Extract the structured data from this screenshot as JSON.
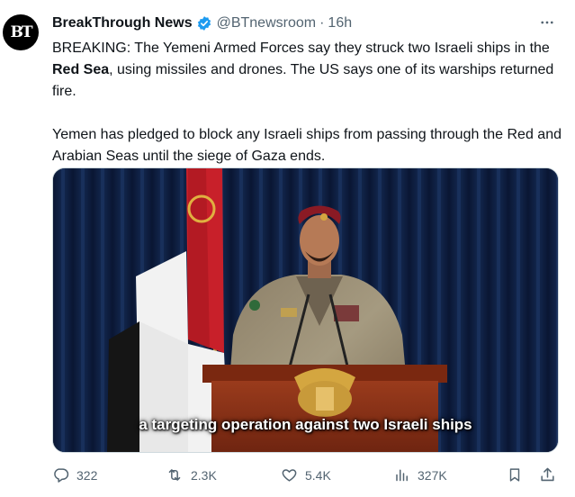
{
  "tweet": {
    "author_name": "BreakThrough News",
    "handle": "@BTnewsroom",
    "dot": "·",
    "time": "16h",
    "avatar_text": "BT",
    "paragraph1_pre": "BREAKING: The Yemeni Armed Forces say they struck two Israeli ships in the ",
    "paragraph1_bold": "Red Sea",
    "paragraph1_post": ", using missiles and drones. The US says one of its warships returned fire.",
    "paragraph2": "Yemen has pledged to block any Israeli ships from passing through the Red and Arabian Seas until the siege of Gaza ends."
  },
  "media": {
    "caption": "a targeting operation against two Israeli ships"
  },
  "actions": {
    "replies": "322",
    "reposts": "2.3K",
    "likes": "5.4K",
    "views": "327K"
  },
  "colors": {
    "verified": "#1d9bf0",
    "muted_text": "#536471",
    "primary_text": "#0f1419"
  },
  "icons": {
    "verified": "verified-badge-icon",
    "more": "more-dots-icon",
    "reply": "reply-icon",
    "repost": "repost-icon",
    "like": "like-icon",
    "views": "views-icon",
    "bookmark": "bookmark-icon",
    "share": "share-icon"
  }
}
